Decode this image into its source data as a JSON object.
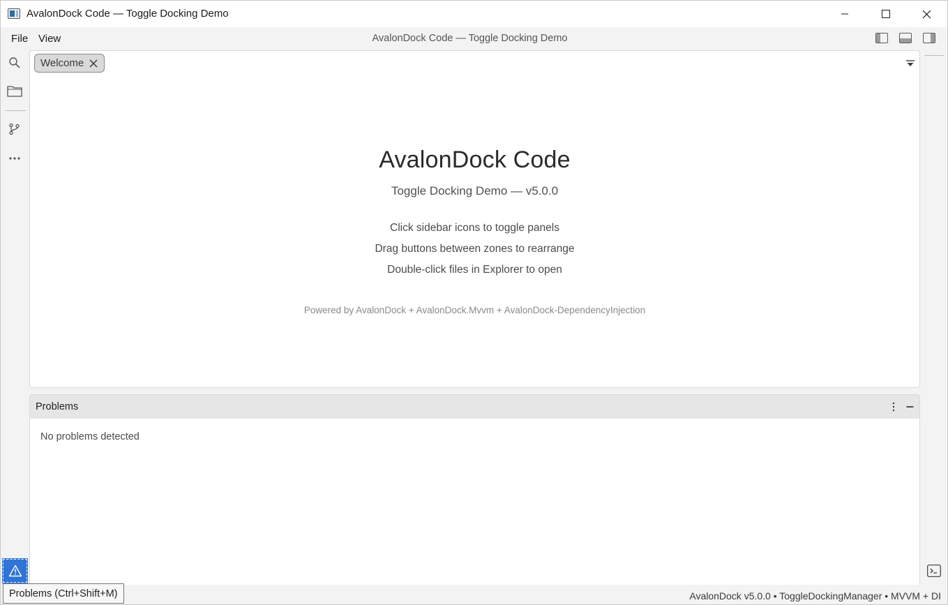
{
  "window": {
    "title": "AvalonDock Code — Toggle Docking Demo",
    "icons": {
      "minimize": "minimize-icon",
      "maximize": "maximize-icon",
      "close": "close-icon",
      "app": "app-icon"
    }
  },
  "menubar": {
    "items": [
      {
        "label": "File"
      },
      {
        "label": "View"
      }
    ],
    "title": "AvalonDock Code — Toggle Docking Demo",
    "layout_icons": [
      "toggle-left-panel-icon",
      "toggle-bottom-panel-icon",
      "toggle-right-panel-icon"
    ]
  },
  "activity_bar": {
    "items": [
      {
        "icon": "search-icon"
      },
      {
        "icon": "folder-icon"
      },
      {
        "icon": "source-control-icon"
      },
      {
        "icon": "more-icon"
      }
    ],
    "bottom_toggle_icon": "warning-icon",
    "accent": "#2f74d6"
  },
  "document": {
    "tabs": [
      {
        "label": "Welcome"
      }
    ],
    "welcome": {
      "title": "AvalonDock Code",
      "subtitle": "Toggle Docking Demo — v5.0.0",
      "lines": [
        "Click sidebar icons to toggle panels",
        "Drag buttons between zones to rearrange",
        "Double-click files in Explorer to open"
      ],
      "powered_by": "Powered by AvalonDock + AvalonDock.Mvvm + AvalonDock-DependencyInjection"
    }
  },
  "problems": {
    "title": "Problems",
    "empty_message": "No problems detected"
  },
  "right_bar": {
    "terminal_icon": "terminal-icon"
  },
  "status": {
    "right_text": "AvalonDock v5.0.0  •  ToggleDockingManager  •  MVVM + DI"
  },
  "tooltip": {
    "text": "Problems (Ctrl+Shift+M)"
  }
}
